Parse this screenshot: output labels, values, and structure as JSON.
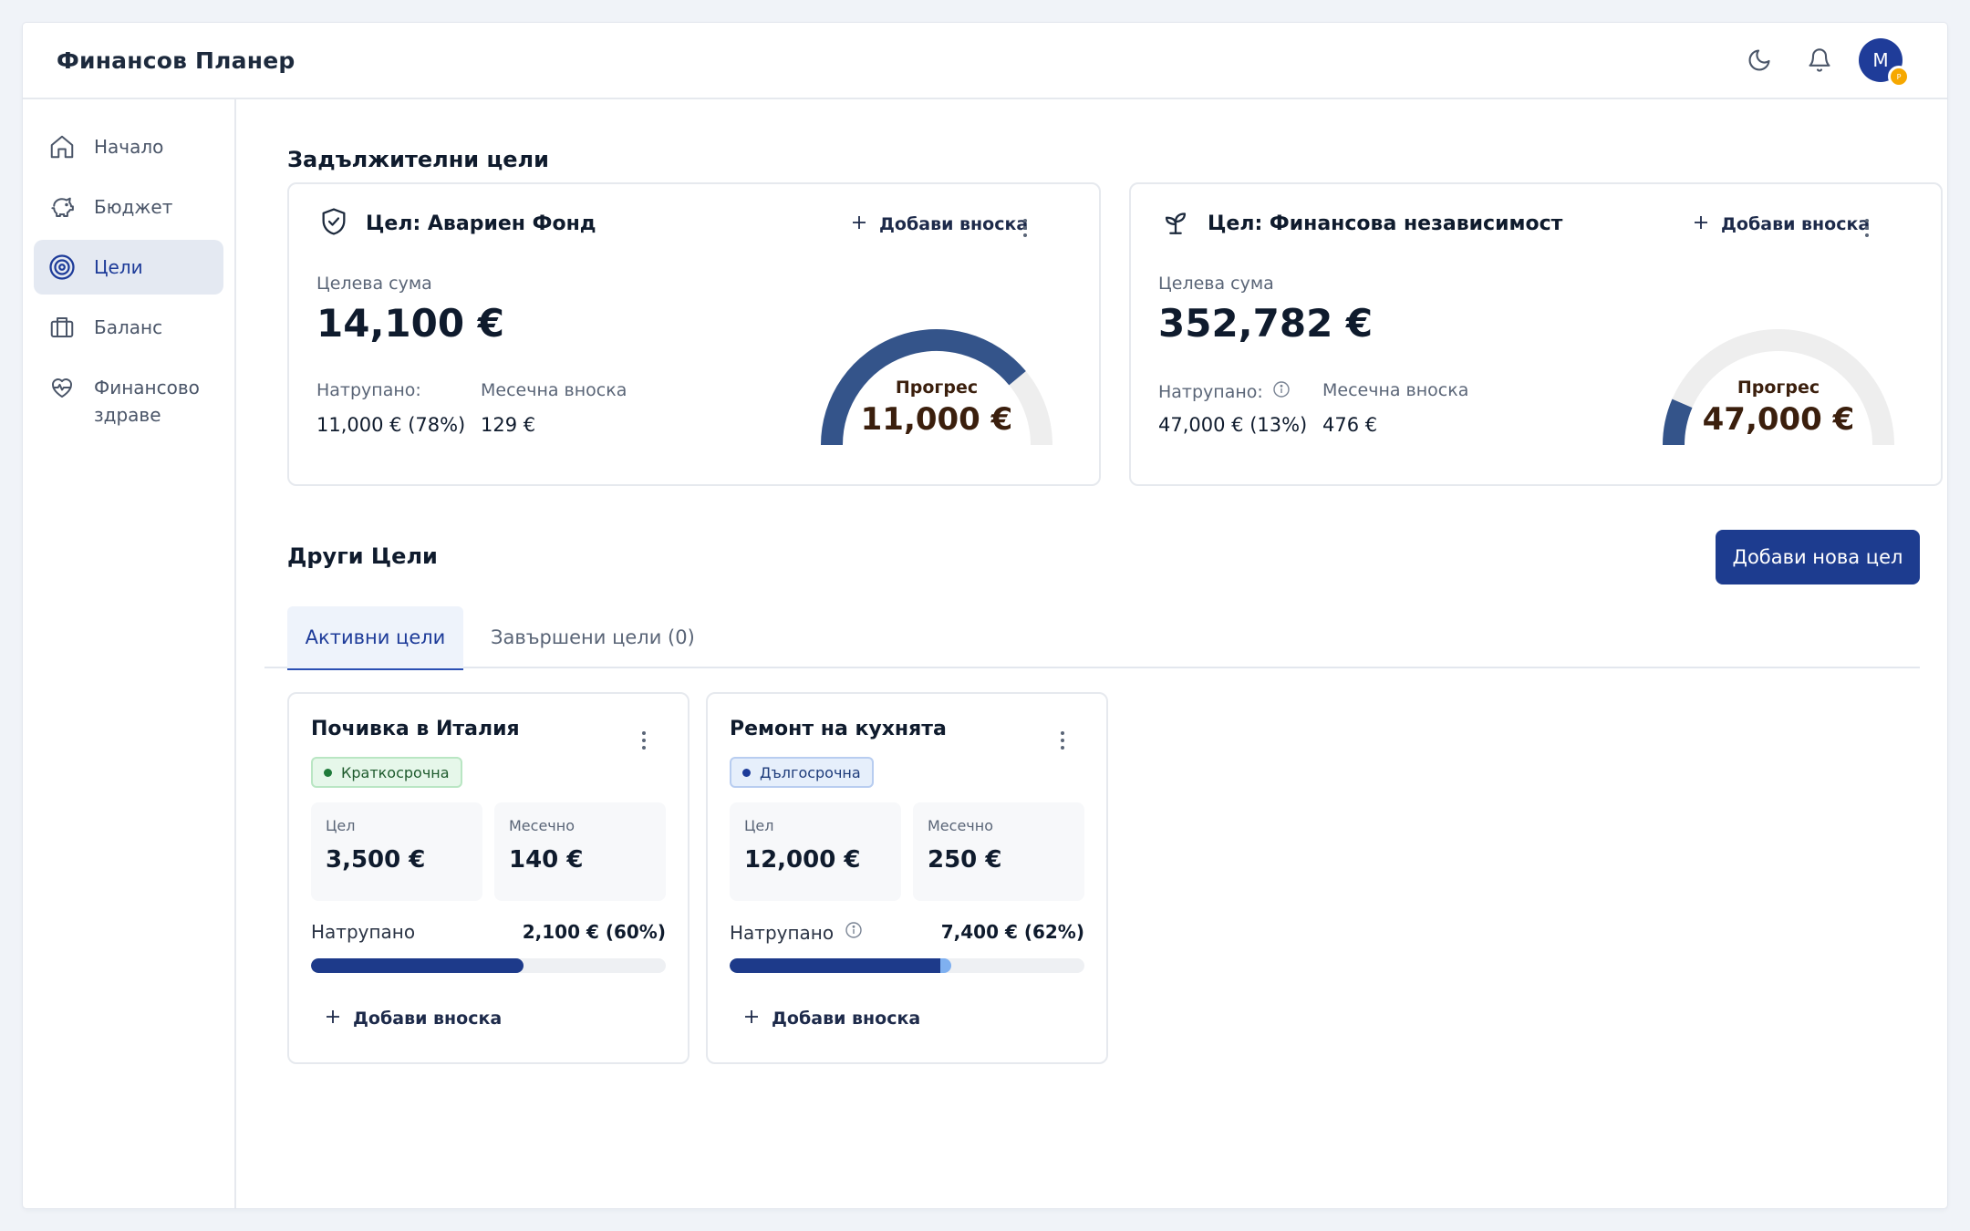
{
  "app": {
    "title": "Финансов Планер",
    "avatar_initial": "M",
    "avatar_badge": "P",
    "accent": "#1d3c8f"
  },
  "header": {
    "icons": [
      "moon-icon",
      "bell-icon"
    ]
  },
  "sidebar": {
    "items": [
      {
        "label": "Начало",
        "icon": "home-icon",
        "active": false
      },
      {
        "label": "Бюджет",
        "icon": "piggy-bank-icon",
        "active": false
      },
      {
        "label": "Цели",
        "icon": "target-icon",
        "active": true
      },
      {
        "label": "Баланс",
        "icon": "briefcase-icon",
        "active": false
      },
      {
        "label": "Финансово здраве",
        "icon": "heart-pulse-icon",
        "active": false
      }
    ]
  },
  "mandatory": {
    "title": "Задължителни цели",
    "cards": [
      {
        "title": "Цел: Авариен Фонд",
        "icon": "shield-check-icon",
        "add_label": "Добави вноска",
        "target_label": "Целева сума",
        "target_amount": "14,100 €",
        "accumulated_label": "Натрупано:",
        "accumulated_value": "11,000 € (78%)",
        "monthly_label": "Месечна вноска",
        "monthly_value": "129 €",
        "progress_label": "Прогрес",
        "progress_value": "11,000 €",
        "progress_fraction": 0.78,
        "has_info": false
      },
      {
        "title": "Цел: Финансова независимост",
        "icon": "sprout-icon",
        "add_label": "Добави вноска",
        "target_label": "Целева сума",
        "target_amount": "352,782 €",
        "accumulated_label": "Натрупано:",
        "accumulated_value": "47,000 € (13%)",
        "monthly_label": "Месечна вноска",
        "monthly_value": "476 €",
        "progress_label": "Прогрес",
        "progress_value": "47,000 €",
        "progress_fraction": 0.13,
        "has_info": true
      }
    ]
  },
  "other": {
    "title": "Други Цели",
    "new_goal_button": "Добави нова цел",
    "tabs": [
      {
        "label": "Активни цели",
        "active": true
      },
      {
        "label": "Завършени цели (0)",
        "active": false
      }
    ],
    "cards": [
      {
        "title": "Почивка в Италия",
        "badge": "Краткосрочна",
        "badge_color": "#1f7a3a",
        "goal_label": "Цел",
        "goal_value": "3,500 €",
        "monthly_label": "Месечно",
        "monthly_value": "140 €",
        "accumulated_label": "Натрупано",
        "accumulated_value": "2,100 € (60%)",
        "progress_fraction": 0.6,
        "add_label": "Добави вноска",
        "has_info": false
      },
      {
        "title": "Ремонт на кухнята",
        "badge": "Дългосрочна",
        "badge_color": "#1d3b99",
        "goal_label": "Цел",
        "goal_value": "12,000 €",
        "monthly_label": "Месечно",
        "monthly_value": "250 €",
        "accumulated_label": "Натрупано",
        "accumulated_value": "7,400 € (62%)",
        "progress_fraction": 0.62,
        "add_label": "Добави вноска",
        "has_info": true
      }
    ]
  }
}
